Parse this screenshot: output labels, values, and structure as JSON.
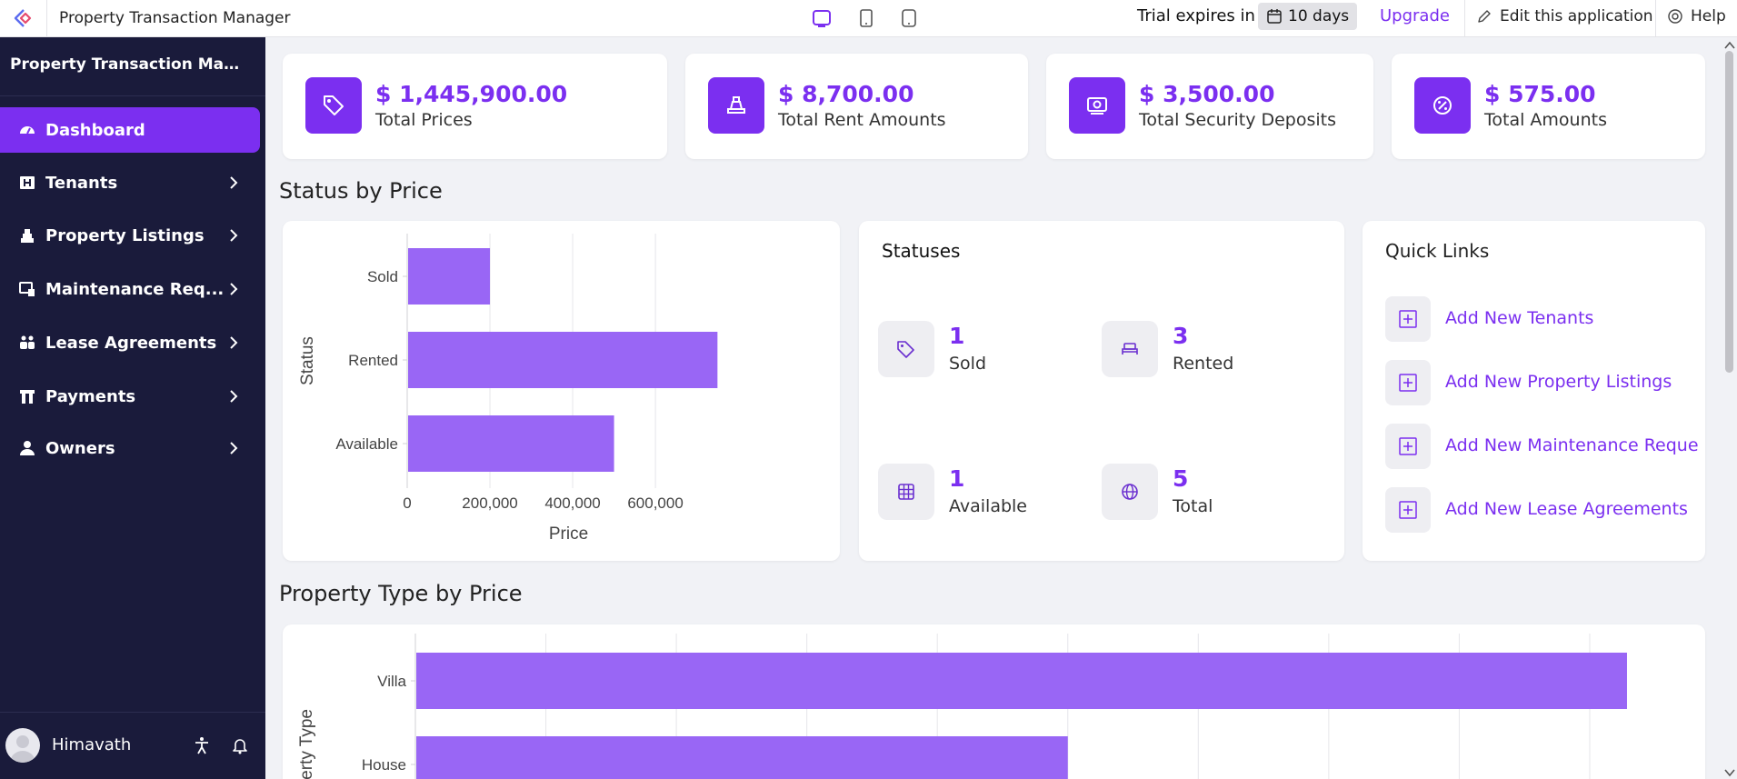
{
  "app": {
    "title": "Property Transaction Manager",
    "trial_text": "Trial expires in",
    "trial_days": "10 days",
    "upgrade": "Upgrade",
    "edit_label": "Edit this application",
    "help_label": "Help"
  },
  "colors": {
    "accent": "#7b2ff0",
    "bar": "#9966f5",
    "sidebar_bg": "#1a1b3b"
  },
  "sidebar": {
    "title": "Property Transaction Man...",
    "items": [
      {
        "label": "Dashboard",
        "icon": "dashboard-icon"
      },
      {
        "label": "Tenants",
        "icon": "tenants-icon"
      },
      {
        "label": "Property Listings",
        "icon": "property-icon"
      },
      {
        "label": "Maintenance Req...",
        "icon": "maintenance-icon"
      },
      {
        "label": "Lease Agreements",
        "icon": "lease-icon"
      },
      {
        "label": "Payments",
        "icon": "payments-icon"
      },
      {
        "label": "Owners",
        "icon": "owners-icon"
      }
    ],
    "user": "Himavath"
  },
  "stats": [
    {
      "value": "$ 1,445,900.00",
      "label": "Total Prices",
      "icon": "tag-icon"
    },
    {
      "value": "$ 8,700.00",
      "label": "Total Rent Amounts",
      "icon": "rent-icon"
    },
    {
      "value": "$ 3,500.00",
      "label": "Total Security Deposits",
      "icon": "deposit-icon"
    },
    {
      "value": "$ 575.00",
      "label": "Total Amounts",
      "icon": "percent-icon"
    }
  ],
  "sections": {
    "status_by_price": "Status by Price",
    "property_type_by_price": "Property Type by Price"
  },
  "statuses": {
    "title": "Statuses",
    "items": [
      {
        "count": "1",
        "label": "Sold",
        "icon": "tag-icon"
      },
      {
        "count": "3",
        "label": "Rented",
        "icon": "bed-icon"
      },
      {
        "count": "1",
        "label": "Available",
        "icon": "grid-icon"
      },
      {
        "count": "5",
        "label": "Total",
        "icon": "globe-icon"
      }
    ]
  },
  "quick_links": {
    "title": "Quick Links",
    "items": [
      {
        "label": "Add New Tenants"
      },
      {
        "label": "Add New Property Listings"
      },
      {
        "label": "Add New Maintenance Reque"
      },
      {
        "label": "Add New Lease Agreements"
      }
    ]
  },
  "chart_data": [
    {
      "type": "bar",
      "orientation": "horizontal",
      "title": "Status by Price",
      "categories": [
        "Sold",
        "Rented",
        "Available"
      ],
      "values": [
        200000,
        750000,
        500000
      ],
      "xlabel": "Price",
      "ylabel": "Status",
      "xlim": [
        0,
        780000
      ],
      "xticks": [
        0,
        200000,
        400000,
        600000
      ],
      "xtick_labels": [
        "0",
        "200,000",
        "400,000",
        "600,000"
      ],
      "grid": true
    },
    {
      "type": "bar",
      "orientation": "horizontal",
      "title": "Property Type by Price",
      "categories": [
        "Villa",
        "House"
      ],
      "values": [
        650000,
        350000
      ],
      "ylabel": "Property Type",
      "xlim": [
        0,
        670000
      ],
      "grid": true
    }
  ]
}
